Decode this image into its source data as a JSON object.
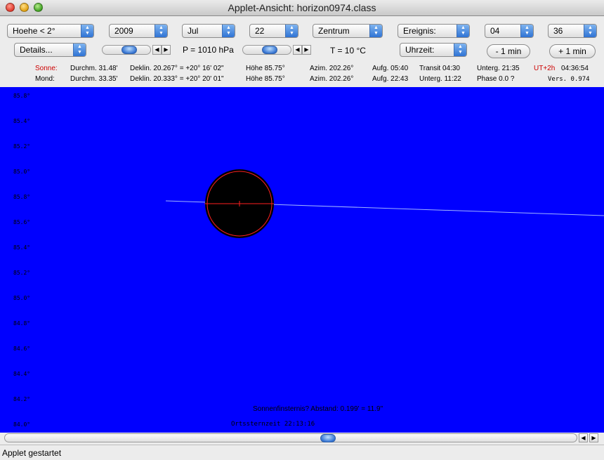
{
  "window": {
    "title": "Applet-Ansicht: horizon0974.class"
  },
  "toolbar": {
    "row1": [
      {
        "name": "height-select",
        "value": "Hoehe < 2°"
      },
      {
        "name": "year-select",
        "value": "2009"
      },
      {
        "name": "month-select",
        "value": "Jul"
      },
      {
        "name": "day-select",
        "value": "22"
      },
      {
        "name": "center-select",
        "value": "Zentrum"
      },
      {
        "name": "event-select",
        "value": "Ereignis:"
      },
      {
        "name": "hour-select",
        "value": "04"
      },
      {
        "name": "minute-select",
        "value": "36"
      }
    ],
    "details": "Details...",
    "time_select": "Uhrzeit:",
    "pressure": "P = 1010 hPa",
    "temperature": "T = 10 °C",
    "minus_min": "- 1 min",
    "plus_min": "+ 1 min"
  },
  "info": {
    "sun": {
      "label": "Sonne:",
      "diameter": "Durchm. 31.48'",
      "declination": "Deklin. 20.267° = +20° 16' 02\"",
      "altitude": "Höhe 85.75°",
      "azimuth": "Azim. 202.26°",
      "rise": "Aufg. 05:40",
      "transit": "Transit 04:30",
      "set": "Unterg. 21:35"
    },
    "moon": {
      "label": "Mond:",
      "diameter": "Durchm. 33.35'",
      "declination": "Deklin. 20.333° = +20° 20' 01\"",
      "altitude": "Höhe 85.75°",
      "azimuth": "Azim. 202.26°",
      "rise": "Aufg. 22:43",
      "set": "Unterg. 11:22",
      "phase": "Phase 0.0 ?"
    },
    "timezone": "UT+2h",
    "clock": "04:36:54",
    "version": "Vers. 0.974"
  },
  "sky": {
    "ticks": [
      "85.8°",
      "85.4°",
      "85.2°",
      "85.0°",
      "85.8°",
      "85.6°",
      "85.4°",
      "85.2°",
      "85.0°",
      "84.8°",
      "84.6°",
      "84.4°",
      "84.2°",
      "84.0°"
    ],
    "eclipse_note": "Sonnenfinsternis? Abstand: 0.199' = 11.9\"",
    "sidereal": "Ortssternzeit 22:13:16",
    "colors": {
      "sky": "#0000ff",
      "sun_outline": "#ff2020",
      "moon": "#000000",
      "horizon_line": "#a0b4ff"
    }
  },
  "status": {
    "text": "Applet gestartet"
  }
}
